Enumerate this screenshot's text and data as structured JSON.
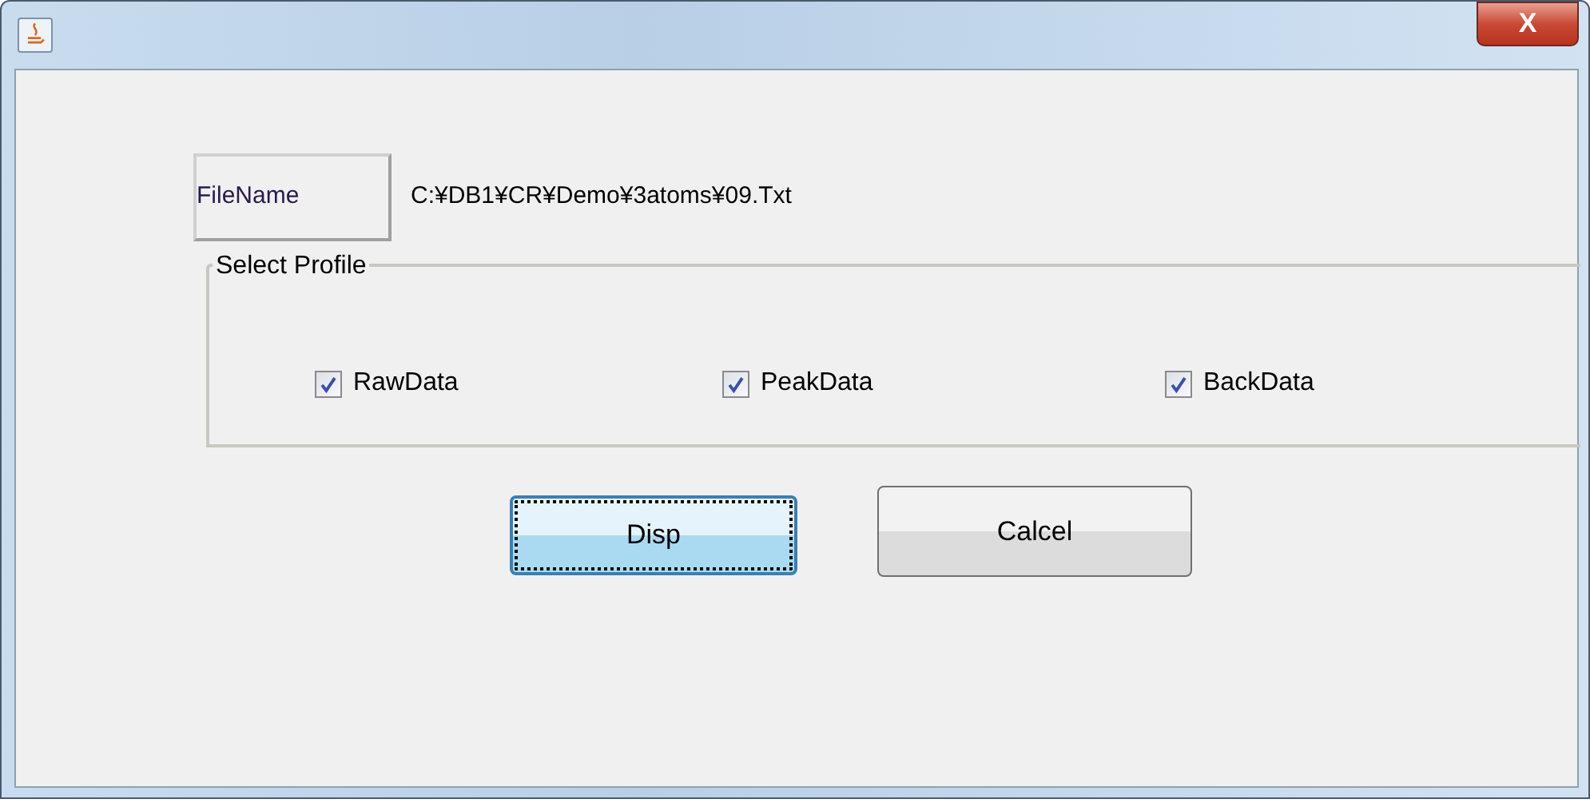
{
  "window": {
    "title_bar": {
      "close_label": "X"
    }
  },
  "file": {
    "label": "FileName",
    "path": "C:¥DB1¥CR¥Demo¥3atoms¥09.Txt"
  },
  "profile_group": {
    "legend": "Select Profile",
    "options": [
      {
        "label": "RawData",
        "checked": true
      },
      {
        "label": "PeakData",
        "checked": true
      },
      {
        "label": "BackData",
        "checked": true
      }
    ]
  },
  "buttons": [
    {
      "label": "Disp",
      "focused": true
    },
    {
      "label": "Calcel",
      "focused": false
    }
  ]
}
